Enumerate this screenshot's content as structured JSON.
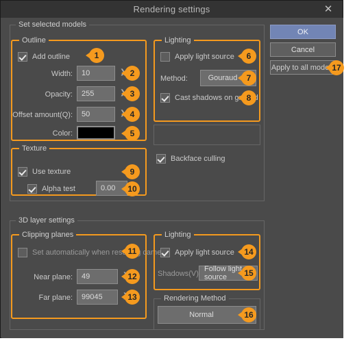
{
  "window": {
    "title": "Rendering settings",
    "close_icon": "close-icon"
  },
  "buttons": {
    "ok": "OK",
    "cancel": "Cancel",
    "apply_all": "Apply to all models"
  },
  "set_selected_models": {
    "legend": "Set selected models",
    "outline": {
      "legend": "Outline",
      "add_outline_label": "Add outline",
      "add_outline_checked": true,
      "width_label": "Width:",
      "width_value": "10",
      "opacity_label": "Opacity:",
      "opacity_value": "255",
      "offset_label": "Offset amount(Q):",
      "offset_value": "50",
      "color_label": "Color:",
      "color_value": "#000000",
      "spinner_icon": "spinner-arrows-icon"
    },
    "texture": {
      "legend": "Texture",
      "use_texture_label": "Use texture",
      "use_texture_checked": true,
      "alpha_test_label": "Alpha test",
      "alpha_test_checked": true,
      "alpha_test_value": "0.00"
    },
    "lighting": {
      "legend": "Lighting",
      "apply_light_label": "Apply light source",
      "apply_light_checked": false,
      "method_label": "Method:",
      "method_value": "Gouraud",
      "cast_shadows_label": "Cast shadows on ground",
      "cast_shadows_checked": true,
      "chevron_icon": "chevron-down-icon"
    },
    "backface_culling_label": "Backface culling",
    "backface_culling_checked": true
  },
  "layer_settings": {
    "legend": "3D layer settings",
    "clipping": {
      "legend": "Clipping planes",
      "auto_label": "Set automatically when resetting camera",
      "auto_checked": false,
      "near_label": "Near plane:",
      "near_value": "49",
      "far_label": "Far plane:",
      "far_value": "99045"
    },
    "lighting": {
      "legend": "Lighting",
      "apply_light_label": "Apply light source",
      "apply_light_checked": true,
      "shadows_label": "Shadows(V):",
      "shadows_value": "Follow light source",
      "chevron_icon": "chevron-down-icon"
    },
    "rendering_method": {
      "legend": "Rendering Method",
      "value": "Normal",
      "chevron_icon": "chevron-down-icon"
    }
  },
  "badges": [
    {
      "n": "1"
    },
    {
      "n": "2"
    },
    {
      "n": "3"
    },
    {
      "n": "4"
    },
    {
      "n": "5"
    },
    {
      "n": "6"
    },
    {
      "n": "7"
    },
    {
      "n": "8"
    },
    {
      "n": "9"
    },
    {
      "n": "10"
    },
    {
      "n": "11"
    },
    {
      "n": "12"
    },
    {
      "n": "13"
    },
    {
      "n": "14"
    },
    {
      "n": "15"
    },
    {
      "n": "16"
    },
    {
      "n": "17"
    }
  ],
  "colors": {
    "accent": "#f59a1e",
    "dialog_bg": "#4a4a4a",
    "titlebar_bg": "#333333",
    "primary_button": "#7285b5"
  }
}
